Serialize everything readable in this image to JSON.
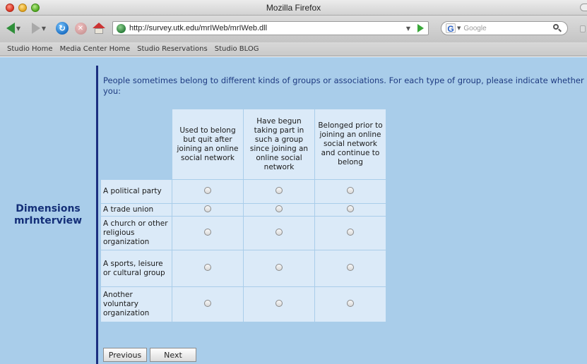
{
  "window": {
    "title": "Mozilla Firefox"
  },
  "toolbar": {
    "url": "http://survey.utk.edu/mrIWeb/mrIWeb.dll",
    "search_placeholder": "Google",
    "search_engine_letter": "G"
  },
  "bookmarks": [
    "Studio Home",
    "Media Center Home",
    "Studio Reservations",
    "Studio BLOG"
  ],
  "sidebar": {
    "brand_line1": "Dimensions",
    "brand_line2": "mrInterview"
  },
  "survey": {
    "question": "People sometimes belong to different kinds of groups or associations. For each type of group, please indicate whether you:",
    "columns": [
      "Used to belong but quit after joining an online social network",
      "Have begun taking part in such a group since joining an online social network",
      "Belonged prior to joining an online social network and continue to belong"
    ],
    "rows": [
      "A political party",
      "A trade union",
      "A church or other religious organization",
      "A sports, leisure or cultural group",
      "Another voluntary organization"
    ],
    "buttons": {
      "previous": "Previous",
      "next": "Next"
    }
  },
  "colors": {
    "page_background": "#a9cdea",
    "grid_cell": "#dbeaf8",
    "brand_text": "#142f78",
    "divider": "#1b2f80"
  }
}
